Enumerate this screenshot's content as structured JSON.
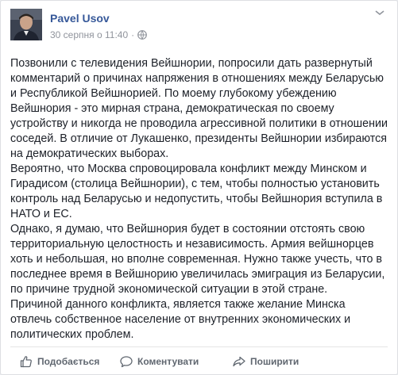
{
  "post": {
    "author": "Pavel Usov",
    "timestamp": "30 серпня о 11:40",
    "separator": "·",
    "paragraphs": [
      "Позвонили с телевидения Вейшнории, попросили дать развернутый комментарий о причинах напряжения в отношениях между Беларусью и Республикой Вейшнорией. По моему глубокому убеждению Вейшнория - это мирная страна, демократическая по своему устройству и никогда не проводила агрессивной политики в отношении соседей. В отличие от Лукашенко, президенты Вейшнории избираются на демократических выборах.",
      "Вероятно, что Москва спровоцировала конфликт между Минском и Гирадисом (столица Вейшнории), с тем, чтобы полностью установить контроль над Беларусью и недопустить, чтобы Вейшнория вступила в НАТО и ЕС.",
      "Однако, я думаю, что Вейшнория будет в состоянии отстоять свою территориальную целостность и независимость. Армия вейшнорцев хоть и небольшая, но вполне современная. Нужно также учесть, что в последнее время в Вейшнорию увеличилась эмиграция из Беларусии, по причине трудной экономической ситуации в этой стране.",
      "Причиной данного конфликта, является также желание Минска отвлечь собственное население от внутренних экономических и политических проблем."
    ]
  },
  "actions": {
    "like_label": "Подобається",
    "comment_label": "Коментувати",
    "share_label": "Поширити"
  },
  "icons": {
    "privacy": "globe-icon",
    "menu": "more-options-icon",
    "like": "thumbs-up-icon",
    "comment": "comment-bubble-icon",
    "share": "share-arrow-icon"
  },
  "colors": {
    "author_link": "#365899",
    "meta_text": "#90949c",
    "body_text": "#1d2129",
    "action_text": "#606770"
  }
}
